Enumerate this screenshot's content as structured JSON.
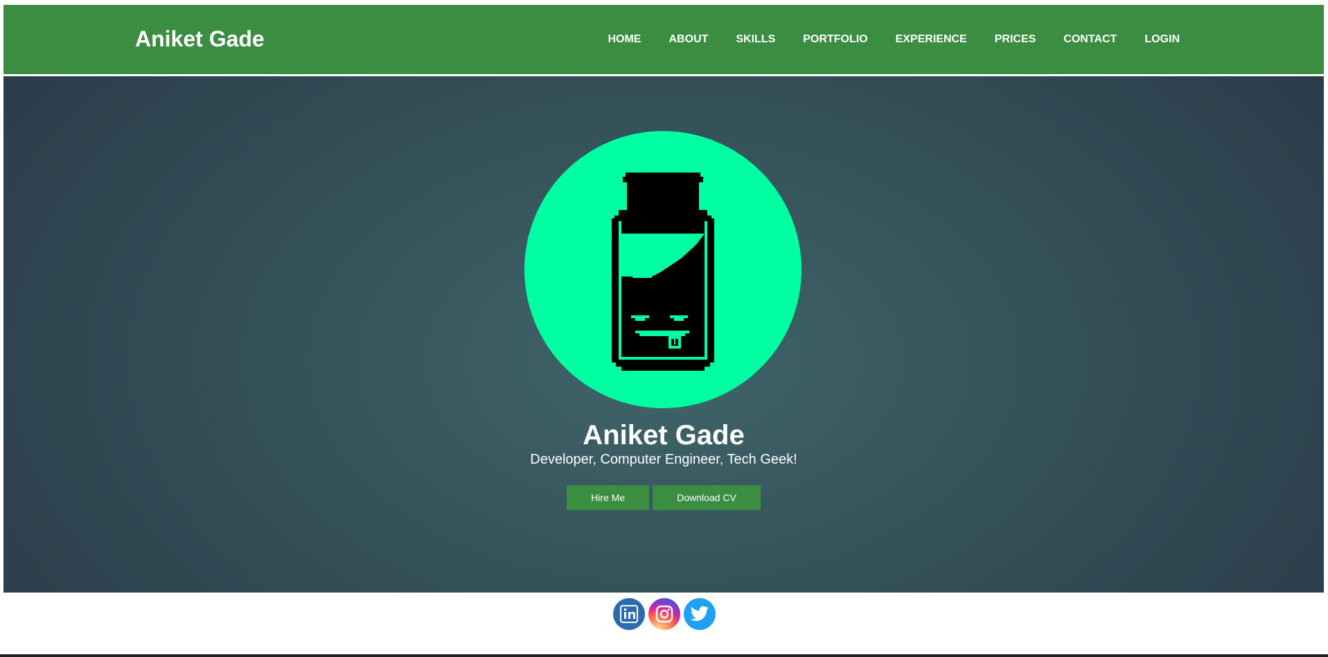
{
  "navbar": {
    "brand": "Aniket Gade",
    "items": [
      {
        "label": "HOME"
      },
      {
        "label": "ABOUT"
      },
      {
        "label": "SKILLS"
      },
      {
        "label": "PORTFOLIO"
      },
      {
        "label": "EXPERIENCE"
      },
      {
        "label": "PRICES"
      },
      {
        "label": "CONTACT"
      },
      {
        "label": "LOGIN"
      }
    ]
  },
  "hero": {
    "name": "Aniket Gade",
    "tagline": "Developer, Computer Engineer, Tech Geek!",
    "buttons": {
      "hire": "Hire Me",
      "download": "Download CV"
    },
    "avatar_icon": "pixel-jar-icon"
  },
  "social": [
    {
      "name": "linkedin-icon"
    },
    {
      "name": "instagram-icon"
    },
    {
      "name": "twitter-icon"
    }
  ],
  "colors": {
    "accent_green": "#3a8d41",
    "avatar_bg": "#00ffa2",
    "hero_dark": "#2a3b49",
    "hero_center": "#3f6569"
  }
}
